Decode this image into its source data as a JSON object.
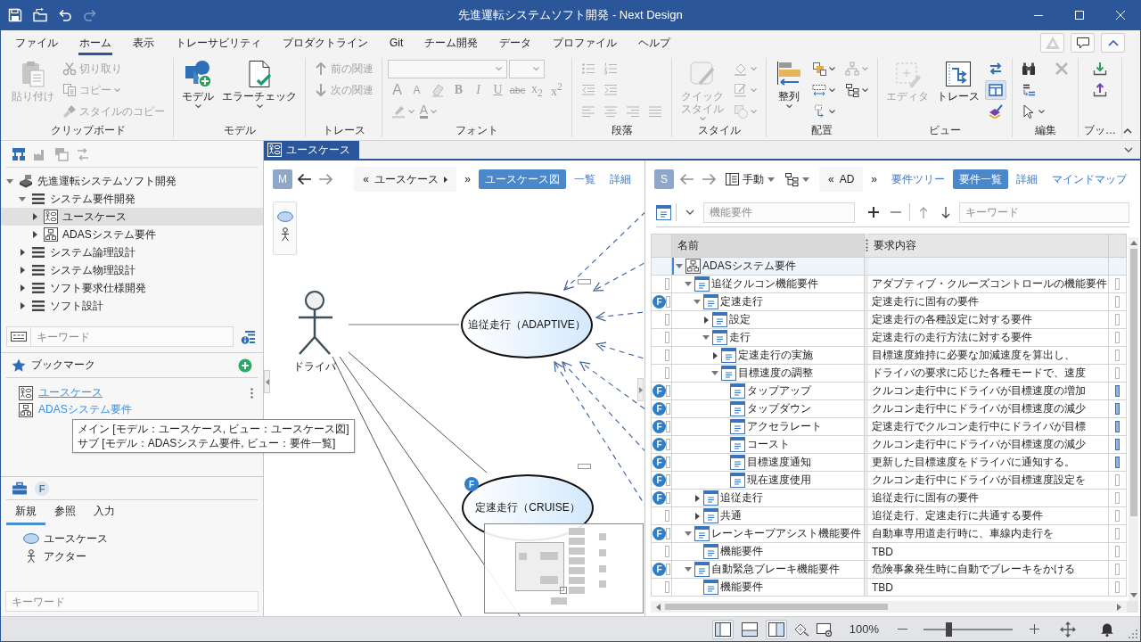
{
  "window": {
    "title": "先進運転システムソフト開発 - Next Design"
  },
  "quick_access": [
    {
      "disabled": false
    },
    {
      "disabled": false
    },
    {
      "disabled": false
    },
    {
      "disabled": true
    }
  ],
  "menu_tabs": [
    {
      "label": "ファイル",
      "selected": false
    },
    {
      "label": "ホーム",
      "selected": true
    },
    {
      "label": "表示",
      "selected": false
    },
    {
      "label": "トレーサビリティ",
      "selected": false
    },
    {
      "label": "プロダクトライン",
      "selected": false
    },
    {
      "label": "Git",
      "selected": false
    },
    {
      "label": "チーム開発",
      "selected": false
    },
    {
      "label": "データ",
      "selected": false
    },
    {
      "label": "プロファイル",
      "selected": false
    },
    {
      "label": "ヘルプ",
      "selected": false
    }
  ],
  "header_buttons": [
    {
      "disabled": true
    },
    {
      "disabled": false
    },
    {
      "disabled": false
    }
  ],
  "ribbon": {
    "groups": [
      {
        "label": "クリップボード",
        "columns": [
          [
            [
              {
                "kind": "large",
                "label": "貼り付け",
                "disabled": true,
                "dropdown": false
              }
            ]
          ],
          [
            [
              {
                "kind": "small",
                "label": "切り取り",
                "disabled": true,
                "dropdown": false
              }
            ],
            [
              {
                "kind": "small",
                "label": "コピー",
                "disabled": true,
                "dropdown": true
              }
            ],
            [
              {
                "kind": "small",
                "label": "スタイルのコピー",
                "disabled": true,
                "dropdown": false
              }
            ]
          ]
        ]
      },
      {
        "label": "モデル",
        "columns": [
          [
            [
              {
                "kind": "large",
                "label": "モデル",
                "disabled": false,
                "dropdown": true
              }
            ]
          ],
          [
            [
              {
                "kind": "large",
                "label": "エラーチェック",
                "disabled": false,
                "dropdown": true
              }
            ]
          ]
        ]
      },
      {
        "label": "トレース",
        "columns": [
          [
            [
              {
                "kind": "small",
                "label": "前の関連",
                "disabled": true,
                "dropdown": false
              }
            ],
            [
              {
                "kind": "small",
                "label": "次の関連",
                "disabled": true,
                "dropdown": false
              }
            ]
          ]
        ]
      },
      {
        "label": "フォント",
        "columns": [
          [
            [
              {
                "kind": "combo",
                "disabled": true
              },
              {
                "kind": "combo",
                "disabled": true
              }
            ],
            [
              {
                "kind": "glyph",
                "label": "A",
                "disabled": true,
                "dropdown": false
              },
              {
                "kind": "glyph",
                "label": "A",
                "disabled": true,
                "dropdown": false
              },
              {
                "kind": "icon",
                "disabled": true,
                "dropdown": false
              },
              {
                "kind": "glyph",
                "label": "B",
                "disabled": true,
                "dropdown": false
              },
              {
                "kind": "glyph",
                "label": "I",
                "disabled": true,
                "dropdown": false
              },
              {
                "kind": "glyph",
                "label": "U",
                "disabled": true,
                "dropdown": false
              },
              {
                "kind": "glyph",
                "label": "abc",
                "disabled": true,
                "dropdown": false
              },
              {
                "kind": "glyph",
                "label": "x$_{2}$",
                "disabled": true,
                "dropdown": false
              },
              {
                "kind": "glyph",
                "label": "x$^{2}$",
                "disabled": true,
                "dropdown": false
              }
            ],
            [
              {
                "kind": "icon",
                "disabled": true,
                "dropdown": true
              },
              {
                "kind": "glyph",
                "label": "A",
                "disabled": true,
                "dropdown": true
              }
            ]
          ]
        ]
      },
      {
        "label": "段落",
        "columns": [
          [
            [
              {
                "kind": "icon",
                "disabled": true,
                "dropdown": false
              },
              {
                "kind": "icon",
                "disabled": true,
                "dropdown": false
              }
            ],
            [
              {
                "kind": "icon",
                "disabled": true,
                "dropdown": false
              },
              {
                "kind": "icon",
                "disabled": true,
                "dropdown": false
              }
            ],
            [
              {
                "kind": "icon",
                "disabled": true,
                "dropdown": false
              },
              {
                "kind": "icon",
                "disabled": true,
                "dropdown": false
              },
              {
                "kind": "icon",
                "disabled": true,
                "dropdown": false
              },
              {
                "kind": "icon",
                "disabled": true,
                "dropdown": false
              }
            ]
          ]
        ]
      },
      {
        "label": "スタイル",
        "columns": [
          [
            [
              {
                "kind": "large",
                "label": "クイックスタイル",
                "disabled": true,
                "dropdown": true
              }
            ]
          ],
          [
            [
              {
                "kind": "icon",
                "disabled": true,
                "dropdown": true
              }
            ],
            [
              {
                "kind": "icon",
                "disabled": true,
                "dropdown": true
              }
            ],
            [
              {
                "kind": "icon",
                "disabled": true,
                "dropdown": true
              }
            ]
          ]
        ]
      },
      {
        "label": "配置",
        "columns": [
          [
            [
              {
                "kind": "large",
                "label": "整列",
                "disabled": false,
                "dropdown": true
              }
            ]
          ],
          [
            [
              {
                "kind": "icon",
                "disabled": false,
                "dropdown": true
              }
            ],
            [
              {
                "kind": "icon",
                "disabled": false,
                "dropdown": true
              }
            ],
            [
              {
                "kind": "icon",
                "disabled": false,
                "dropdown": true
              }
            ]
          ],
          [
            [
              {
                "kind": "icon",
                "disabled": true,
                "dropdown": true
              }
            ],
            [
              {
                "kind": "icon",
                "disabled": false,
                "dropdown": true
              }
            ]
          ]
        ]
      },
      {
        "label": "ビュー",
        "columns": [
          [
            [
              {
                "kind": "large",
                "label": "エディタ",
                "disabled": true,
                "dropdown": false
              }
            ]
          ],
          [
            [
              {
                "kind": "large",
                "label": "トレース",
                "disabled": false,
                "dropdown": false
              }
            ]
          ],
          [
            [
              {
                "kind": "icon",
                "disabled": false,
                "dropdown": false,
                "pressed": false
              }
            ],
            [
              {
                "kind": "icon",
                "disabled": false,
                "dropdown": false,
                "pressed": true
              }
            ],
            [
              {
                "kind": "icon",
                "disabled": false,
                "dropdown": false,
                "pressed": false
              }
            ]
          ]
        ]
      },
      {
        "label": "編集",
        "columns": [
          [
            [
              {
                "kind": "icon",
                "disabled": false,
                "dropdown": false
              }
            ],
            [
              {
                "kind": "icon",
                "disabled": false,
                "dropdown": false
              }
            ],
            [
              {
                "kind": "icon",
                "disabled": false,
                "dropdown": true
              }
            ]
          ],
          [
            [
              {
                "kind": "icon",
                "disabled": true,
                "dropdown": false
              }
            ]
          ]
        ]
      },
      {
        "label": "ブッ…",
        "columns": [
          [
            [
              {
                "kind": "icon",
                "disabled": false,
                "dropdown": false
              }
            ],
            [
              {
                "kind": "icon",
                "disabled": false,
                "dropdown": false
              }
            ]
          ]
        ]
      }
    ]
  },
  "model_panel": {
    "toolbar": [
      {
        "disabled": false
      },
      {
        "disabled": true
      },
      {
        "disabled": true
      },
      {
        "disabled": true
      }
    ],
    "tree": [
      {
        "label": "先進運転システムソフト開発",
        "kind": "project",
        "expanded": true,
        "selected": false,
        "children": [
          {
            "label": "システム要件開発",
            "kind": "package",
            "expanded": true,
            "selected": false,
            "children": [
              {
                "label": "ユースケース",
                "kind": "usecase",
                "expanded": false,
                "selected": true
              },
              {
                "label": "ADASシステム要件",
                "kind": "requirements",
                "expanded": false,
                "selected": false
              }
            ]
          },
          {
            "label": "システム論理設計",
            "kind": "package",
            "expanded": false,
            "selected": false
          },
          {
            "label": "システム物理設計",
            "kind": "package",
            "expanded": false,
            "selected": false
          },
          {
            "label": "ソフト要求仕様開発",
            "kind": "package",
            "expanded": false,
            "selected": false
          },
          {
            "label": "ソフト設計",
            "kind": "package",
            "expanded": false,
            "selected": false
          }
        ]
      }
    ],
    "search": {
      "placeholder": "キーワード"
    }
  },
  "bookmarks": {
    "title": "ブックマーク",
    "items": [
      {
        "label": "ユースケース",
        "kind": "usecase",
        "hovered": true
      },
      {
        "label": "ADASシステム要件",
        "kind": "requirements",
        "hovered": false
      }
    ],
    "tooltip": [
      "メイン [モデル：ユースケース, ビュー：ユースケース図]",
      "サブ [モデル：ADASシステム要件, ビュー：要件一覧]"
    ]
  },
  "toolbox": {
    "filter": {
      "label": "F",
      "disabled": true
    },
    "tabs": [
      {
        "label": "新規",
        "selected": true
      },
      {
        "label": "参照",
        "selected": false
      },
      {
        "label": "入力",
        "selected": false
      }
    ],
    "items": [
      {
        "label": "ユースケース",
        "kind": "usecase"
      },
      {
        "label": "アクター",
        "kind": "actor"
      }
    ],
    "search": {
      "placeholder": "キーワード"
    }
  },
  "document_tabs": [
    {
      "label": "ユースケース",
      "selected": true
    }
  ],
  "main_view": {
    "badge": "M",
    "back": {
      "disabled": false
    },
    "forward": {
      "disabled": true
    },
    "breadcrumb": {
      "back": "«",
      "label": "ユースケース",
      "has_menu": true,
      "forward": "»"
    },
    "views": [
      {
        "label": "ユースケース図",
        "selected": true
      },
      {
        "label": "一覧",
        "selected": false
      },
      {
        "label": "詳細",
        "selected": false
      }
    ],
    "palette": [
      {
        "kind": "usecase"
      },
      {
        "kind": "actor"
      }
    ],
    "diagram": {
      "actors": [
        {
          "label": "ドライバ"
        }
      ],
      "use_cases": [
        {
          "label": "追従走行（ADAPTIVE）"
        },
        {
          "label": "定速走行（CRUISE）",
          "badge": "F"
        }
      ]
    }
  },
  "sub_view": {
    "badge": "S",
    "back": {
      "disabled": true
    },
    "forward": {
      "disabled": true
    },
    "layout_menu": {
      "label": "手動"
    },
    "breadcrumb": {
      "back": "«",
      "label": "AD",
      "forward": "»"
    },
    "views": [
      {
        "label": "要件ツリー",
        "selected": false
      },
      {
        "label": "要件一覧",
        "selected": true
      },
      {
        "label": "詳細",
        "selected": false
      },
      {
        "label": "マインドマップ",
        "selected": false
      }
    ],
    "toolbar": {
      "type_field": {
        "placeholder": "機能要件"
      },
      "add": {
        "disabled": false
      },
      "remove": {
        "disabled": true
      },
      "move_up": {
        "disabled": true
      },
      "move_down": {
        "disabled": false
      },
      "search": {
        "placeholder": "キーワード"
      }
    },
    "table": {
      "columns": [
        {
          "label": "名前",
          "selected": true
        },
        {
          "label": "要求内容",
          "selected": false
        }
      ],
      "rows": [
        {
          "name": "ADASシステム要件",
          "kind": "model",
          "expanded": true,
          "selected": true,
          "children": [
            {
              "name": "追従クルコン機能要件",
              "content": "アダプティブ・クルーズコントロールの機能要件",
              "kind": "requirement",
              "expanded": true,
              "selected": false,
              "marked": false,
              "children": [
                {
                  "name": "定速走行",
                  "content": "定速走行に固有の要件",
                  "badge": "F",
                  "kind": "requirement",
                  "expanded": true,
                  "selected": false,
                  "marked": false,
                  "children": [
                    {
                      "name": "設定",
                      "content": "定速走行の各種設定に対する要件",
                      "kind": "requirement",
                      "expanded": false,
                      "selected": false,
                      "marked": false
                    },
                    {
                      "name": "走行",
                      "content": "定速走行の走行方法に対する要件",
                      "kind": "requirement",
                      "expanded": true,
                      "selected": false,
                      "marked": false,
                      "children": [
                        {
                          "name": "定速走行の実施",
                          "content": "目標速度維持に必要な加減速度を算出し、",
                          "kind": "requirement",
                          "expanded": false,
                          "selected": false,
                          "marked": false
                        },
                        {
                          "name": "目標速度の調整",
                          "content": "ドライバの要求に応じた各種モードで、速度",
                          "kind": "requirement",
                          "expanded": true,
                          "selected": false,
                          "marked": false,
                          "children": [
                            {
                              "name": "タップアップ",
                              "content": "クルコン走行中にドライバが目標速度の増加",
                              "badge": "F",
                              "kind": "requirement",
                              "selected": false,
                              "marked": true
                            },
                            {
                              "name": "タップダウン",
                              "content": "クルコン走行中にドライバが目標速度の減少",
                              "badge": "F",
                              "kind": "requirement",
                              "selected": false,
                              "marked": true
                            },
                            {
                              "name": "アクセラレート",
                              "content": "定速走行でクルコン走行中にドライバが目標",
                              "badge": "F",
                              "kind": "requirement",
                              "selected": false,
                              "marked": true
                            },
                            {
                              "name": "コースト",
                              "content": "クルコン走行中にドライバが目標速度の減少",
                              "badge": "F",
                              "kind": "requirement",
                              "selected": false,
                              "marked": true
                            },
                            {
                              "name": "目標速度通知",
                              "content": "更新した目標速度をドライバに通知する。",
                              "badge": "F",
                              "kind": "requirement",
                              "selected": false,
                              "marked": true
                            },
                            {
                              "name": "現在速度使用",
                              "content": "クルコン走行中にドライバが目標速度設定を",
                              "badge": "F",
                              "kind": "requirement",
                              "selected": false,
                              "marked": false
                            }
                          ]
                        }
                      ]
                    }
                  ]
                },
                {
                  "name": "追従走行",
                  "content": "追従走行に固有の要件",
                  "badge": "F",
                  "kind": "requirement",
                  "expanded": false,
                  "selected": false,
                  "marked": false
                },
                {
                  "name": "共通",
                  "content": "追従走行、定速走行に共通する要件",
                  "kind": "requirement",
                  "expanded": false,
                  "selected": false,
                  "marked": false
                }
              ]
            },
            {
              "name": "レーンキープアシスト機能要件",
              "content": "自動車専用道走行時に、車線内走行を",
              "badge": "F",
              "kind": "requirement",
              "expanded": true,
              "selected": false,
              "marked": false,
              "children": [
                {
                  "name": "機能要件",
                  "content": "TBD",
                  "kind": "requirement",
                  "selected": false,
                  "marked": false
                }
              ]
            },
            {
              "name": "自動緊急ブレーキ機能要件",
              "content": "危険事象発生時に自動でブレーキをかける",
              "badge": "F",
              "kind": "requirement",
              "expanded": true,
              "selected": false,
              "marked": false,
              "children": [
                {
                  "name": "機能要件",
                  "content": "TBD",
                  "kind": "requirement",
                  "selected": false,
                  "marked": false
                }
              ]
            }
          ]
        }
      ]
    }
  },
  "status_bar": {
    "layouts": [
      {
        "selected": true
      },
      {
        "selected": false
      },
      {
        "selected": true
      }
    ],
    "zoom": {
      "label": "100%",
      "level": 0.29
    }
  }
}
